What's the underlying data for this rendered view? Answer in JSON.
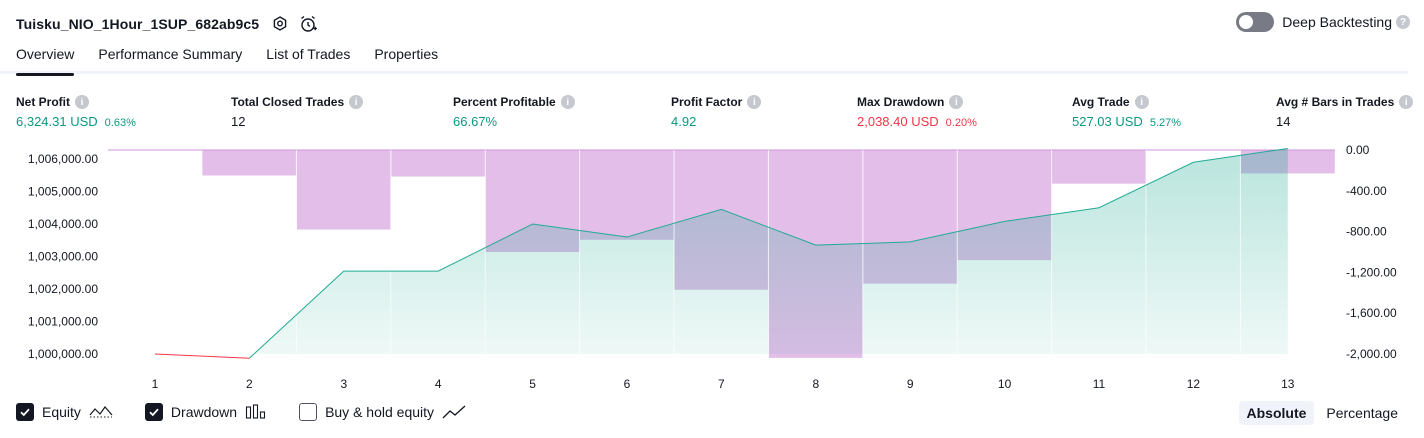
{
  "header": {
    "title": "Tuisku_NIO_1Hour_1SUP_682ab9c5",
    "deep_backtesting_label": "Deep Backtesting",
    "deep_backtesting_on": false
  },
  "tabs": [
    {
      "label": "Overview",
      "active": true
    },
    {
      "label": "Performance Summary",
      "active": false
    },
    {
      "label": "List of Trades",
      "active": false
    },
    {
      "label": "Properties",
      "active": false
    }
  ],
  "metrics": [
    {
      "label": "Net Profit",
      "value": "6,324.31 USD",
      "pct": "0.63%",
      "color": "#089981"
    },
    {
      "label": "Total Closed Trades",
      "value": "12",
      "pct": "",
      "color": "#131722"
    },
    {
      "label": "Percent Profitable",
      "value": "66.67%",
      "pct": "",
      "color": "#089981"
    },
    {
      "label": "Profit Factor",
      "value": "4.92",
      "pct": "",
      "color": "#089981"
    },
    {
      "label": "Max Drawdown",
      "value": "2,038.40 USD",
      "pct": "0.20%",
      "color": "#f23645"
    },
    {
      "label": "Avg Trade",
      "value": "527.03 USD",
      "pct": "5.27%",
      "color": "#089981"
    },
    {
      "label": "Avg # Bars in Trades",
      "value": "14",
      "pct": "",
      "color": "#131722"
    }
  ],
  "chart_data": {
    "type": "area",
    "x": [
      1,
      2,
      3,
      4,
      5,
      6,
      7,
      8,
      9,
      10,
      11,
      12,
      13
    ],
    "left_axis_ticks": [
      "1,006,000.00",
      "1,005,000.00",
      "1,004,000.00",
      "1,003,000.00",
      "1,002,000.00",
      "1,001,000.00",
      "1,000,000.00"
    ],
    "right_axis_ticks": [
      "0.00",
      "-400.00",
      "-800.00",
      "-1,200.00",
      "-1,600.00",
      "-2,000.00"
    ],
    "ylim_left": [
      999750,
      1006300
    ],
    "ylim_right": [
      -2050,
      50
    ],
    "series": [
      {
        "name": "Equity",
        "values": [
          1000000,
          999870,
          1002550,
          1002550,
          1004000,
          1003600,
          1004450,
          1003350,
          1003450,
          1004080,
          1004500,
          1005900,
          1006324.31
        ],
        "color": "#22ab94"
      },
      {
        "name": "Drawdown",
        "values": [
          0,
          -250,
          -780,
          -260,
          -1000,
          -880,
          -1370,
          -2038.4,
          -1310,
          -1080,
          -330,
          0,
          -230
        ],
        "color": "#ce93d8"
      }
    ]
  },
  "legend": [
    {
      "label": "Equity",
      "checked": true,
      "icon": "equity-wave-icon"
    },
    {
      "label": "Drawdown",
      "checked": true,
      "icon": "drawdown-bars-icon"
    },
    {
      "label": "Buy & hold equity",
      "checked": false,
      "icon": "buy-hold-line-icon"
    }
  ],
  "mode": {
    "absolute_label": "Absolute",
    "percentage_label": "Percentage",
    "selected": "Absolute"
  }
}
